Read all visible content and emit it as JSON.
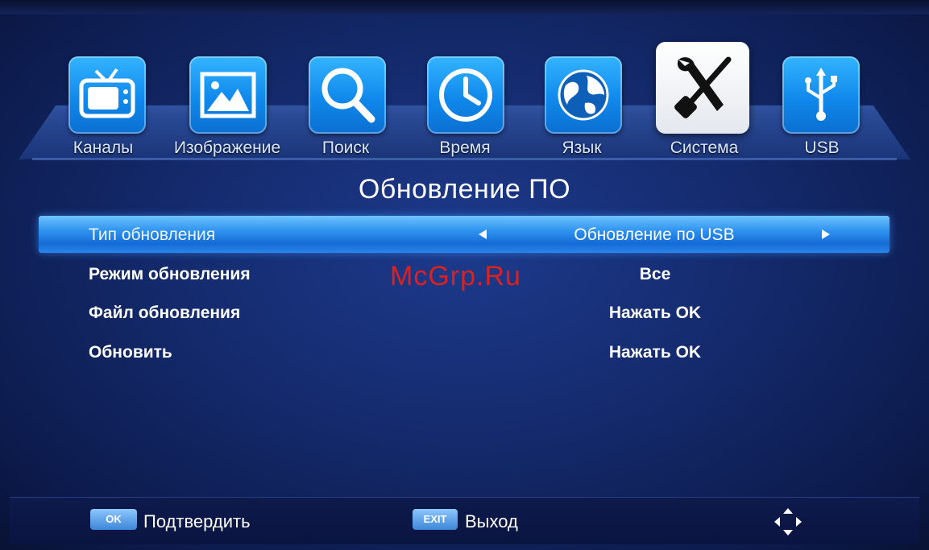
{
  "menu": {
    "tabs": [
      {
        "label": "Каналы",
        "icon": "tv-icon"
      },
      {
        "label": "Изображение",
        "icon": "picture-icon"
      },
      {
        "label": "Поиск",
        "icon": "search-icon"
      },
      {
        "label": "Время",
        "icon": "clock-icon"
      },
      {
        "label": "Язык",
        "icon": "globe-icon"
      },
      {
        "label": "Система",
        "icon": "tools-icon",
        "active": true
      },
      {
        "label": "USB",
        "icon": "usb-icon"
      }
    ]
  },
  "page": {
    "title": "Обновление ПО",
    "rows": [
      {
        "label": "Тип обновления",
        "value": "Обновление по USB",
        "selected": true
      },
      {
        "label": "Режим обновления",
        "value": "Все"
      },
      {
        "label": "Файл обновления",
        "value": "Нажать OK"
      },
      {
        "label": "Обновить",
        "value": "Нажать OK"
      }
    ]
  },
  "watermark": "McGrp.Ru",
  "footer": {
    "ok_key": "OK",
    "ok_label": "Подтвердить",
    "exit_key": "EXIT",
    "exit_label": "Выход"
  },
  "colors": {
    "accent": "#1089ec",
    "selection": "#2f93f0",
    "watermark": "#e0201d"
  }
}
